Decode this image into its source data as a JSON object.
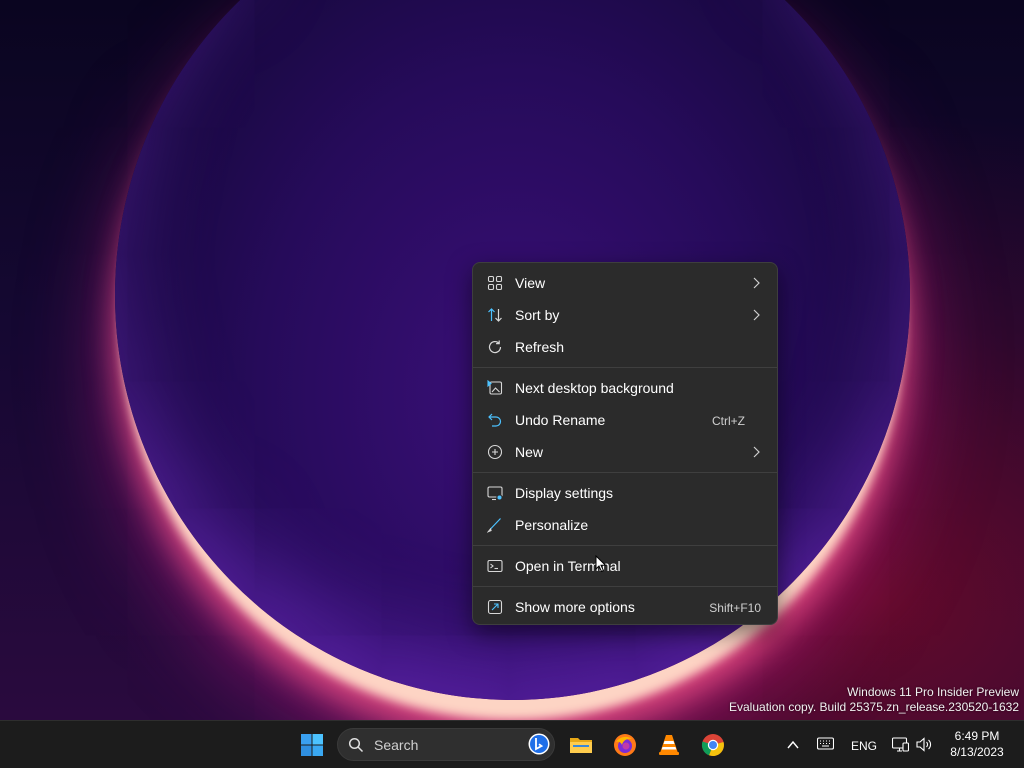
{
  "desktop": {
    "watermark_line1": "Windows 11 Pro Insider Preview",
    "watermark_line2": "Evaluation copy. Build 25375.zn_release.230520-1632"
  },
  "context_menu": {
    "items": [
      {
        "label": "View",
        "icon": "grid-view-icon",
        "submenu": true
      },
      {
        "label": "Sort by",
        "icon": "sort-icon",
        "submenu": true
      },
      {
        "label": "Refresh",
        "icon": "refresh-icon"
      },
      {
        "label": "Next desktop background",
        "icon": "next-background-icon"
      },
      {
        "label": "Undo Rename",
        "icon": "undo-icon",
        "shortcut": "Ctrl+Z"
      },
      {
        "label": "New",
        "icon": "new-plus-icon",
        "submenu": true
      },
      {
        "label": "Display settings",
        "icon": "display-settings-icon"
      },
      {
        "label": "Personalize",
        "icon": "pen-brush-icon"
      },
      {
        "label": "Open in Terminal",
        "icon": "terminal-icon"
      },
      {
        "label": "Show more options",
        "icon": "more-options-icon",
        "shortcut": "Shift+F10"
      }
    ]
  },
  "taskbar": {
    "search_placeholder": "Search",
    "apps": [
      "start-button",
      "file-explorer",
      "firefox",
      "vlc",
      "chrome"
    ],
    "language": "ENG",
    "clock_time": "6:49 PM",
    "clock_date": "8/13/2023"
  },
  "colors": {
    "menu_bg": "#2b2b2b",
    "accent": "#4cc2ff",
    "taskbar_bg": "#1c1c1c"
  }
}
